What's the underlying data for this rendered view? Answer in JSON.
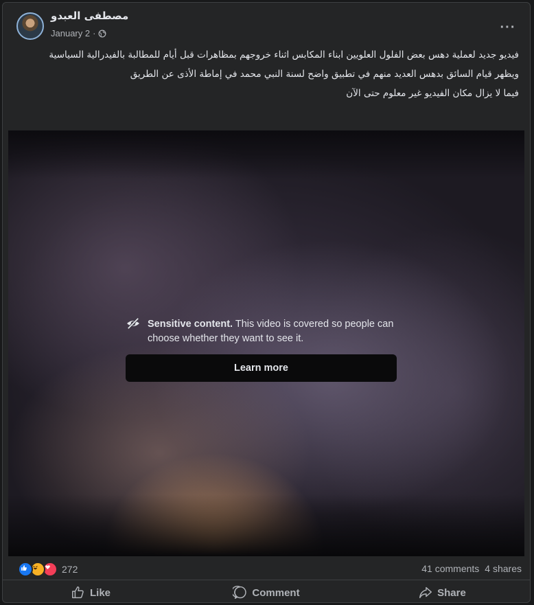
{
  "post": {
    "author": "مصطفى العبدو",
    "date": "January 2",
    "date_separator": "·",
    "more_label": "···",
    "text": [
      "فيديو جديد لعملية دهس بعض الفلول العلويين ابناء المكابس اثناء خروجهم بمظاهرات  قبل أيام للمطالبة بالفيدرالية السياسية",
      "ويظهر قيام السائق بدهس العديد منهم في تطبيق واضح لسنة النبي محمد في إماطة الأذى عن الطريق",
      "فيما لا يزال مكان الفيديو غير معلوم حتى الآن"
    ]
  },
  "video": {
    "notice_title": "Sensitive content.",
    "notice_body": " This video is covered so people can choose whether they want to see it.",
    "learn_more_label": "Learn more"
  },
  "stats": {
    "reaction_count": "272",
    "comments": "41 comments",
    "shares": "4 shares"
  },
  "actions": {
    "like": "Like",
    "comment": "Comment",
    "share": "Share"
  },
  "colors": {
    "background": "#18191a",
    "card": "#242526",
    "text_primary": "#e4e6eb",
    "text_secondary": "#b0b3b8",
    "like_blue": "#1877f2",
    "haha_yellow": "#f7b125",
    "love_red": "#f33e58"
  },
  "icons": [
    "globe-icon",
    "more-icon",
    "eye-off-icon",
    "like-reaction-icon",
    "haha-reaction-icon",
    "love-reaction-icon",
    "thumbs-up-icon",
    "comment-icon",
    "share-icon"
  ]
}
